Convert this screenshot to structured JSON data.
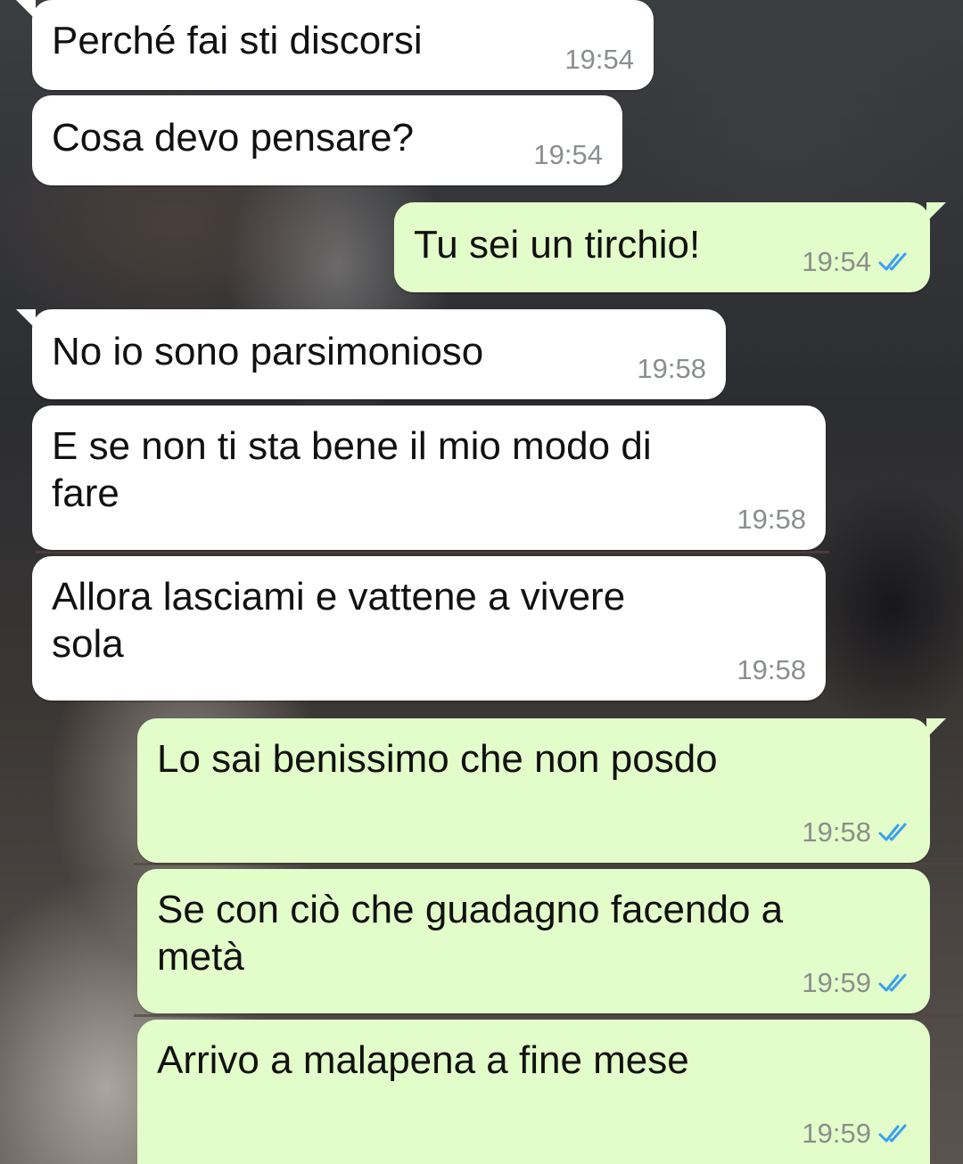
{
  "colors": {
    "incoming_bubble": "#ffffff",
    "outgoing_bubble": "#e2fdc9",
    "timestamp": "#8a8f8c",
    "read_checks": "#3aa0f0"
  },
  "messages": [
    {
      "direction": "in",
      "text": "Perché fai sti discorsi",
      "time": "19:54"
    },
    {
      "direction": "in",
      "text": "Cosa devo pensare?",
      "time": "19:54"
    },
    {
      "direction": "out",
      "text": "Tu sei un tirchio!",
      "time": "19:54",
      "status_icon": "double-check-read-icon"
    },
    {
      "direction": "in",
      "text": "No io sono parsimonioso",
      "time": "19:58"
    },
    {
      "direction": "in",
      "text": "E se non ti sta bene il mio modo di\nfare",
      "time": "19:58"
    },
    {
      "direction": "in",
      "text": "Allora lasciami e vattene a vivere\nsola",
      "time": "19:58"
    },
    {
      "direction": "out",
      "text": "Lo sai benissimo che non posdo",
      "time": "19:58",
      "status_icon": "double-check-read-icon"
    },
    {
      "direction": "out",
      "text": "Se con ciò che guadagno facendo a\nmetà",
      "time": "19:59",
      "status_icon": "double-check-read-icon"
    },
    {
      "direction": "out",
      "text": "Arrivo a malapena a fine mese",
      "time": "19:59",
      "status_icon": "double-check-read-icon"
    }
  ]
}
